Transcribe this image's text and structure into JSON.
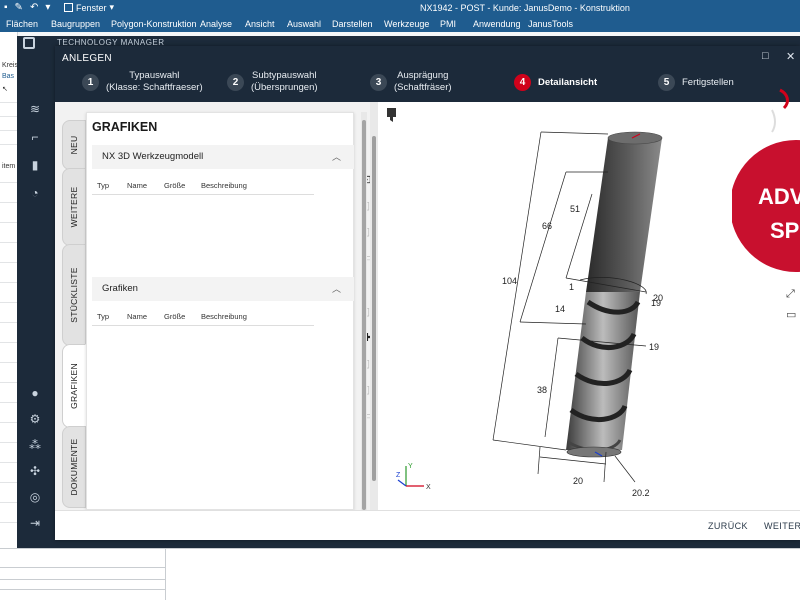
{
  "nx": {
    "title": "NX1942 - POST - Kunde: JanusDemo - Konstruktion",
    "window_menu": "Fenster",
    "menu": [
      "Flächen",
      "Baugruppen",
      "Polygon-Konstruktion",
      "Analyse",
      "Ansicht",
      "Auswahl",
      "Darstellen",
      "Werkzeuge",
      "PMI",
      "Anwendung",
      "JanusTools"
    ],
    "left_strip": [
      "Kreis",
      "Bas",
      "item (N"
    ]
  },
  "tm": {
    "title": "TECHNOLOGY MANAGER"
  },
  "dialog": {
    "title": "ANLEGEN",
    "steps": [
      {
        "num": "1",
        "line1": "Typauswahl",
        "line2": "(Klasse: Schaftfraeser)"
      },
      {
        "num": "2",
        "line1": "Subtypauswahl",
        "line2": "(Übersprungen)"
      },
      {
        "num": "3",
        "line1": "Ausprägung",
        "line2": "(Schaftfräser)"
      },
      {
        "num": "4",
        "line1": "Detailansicht",
        "line2": ""
      },
      {
        "num": "5",
        "line1": "Fertigstellen",
        "line2": ""
      }
    ],
    "active_step": 4,
    "accent": "#d0021b",
    "tabs": [
      "NEU",
      "WEITERE",
      "STÜCKLISTE",
      "GRAFIKEN",
      "DOKUMENTE"
    ],
    "active_tab": "GRAFIKEN",
    "panel": {
      "title": "GRAFIKEN",
      "sections": [
        {
          "title": "NX 3D Werkzeugmodell",
          "columns": [
            "Typ",
            "Name",
            "Größe",
            "Beschreibung"
          ]
        },
        {
          "title": "Grafiken",
          "columns": [
            "Typ",
            "Name",
            "Größe",
            "Beschreibung"
          ]
        }
      ]
    },
    "footer": {
      "back": "ZURÜCK",
      "next": "WEITER"
    }
  },
  "drawing": {
    "dimensions": {
      "overall": "104",
      "d66": "66",
      "d51": "51",
      "d14": "14",
      "d38": "38",
      "d1": "1",
      "d20_top": "20",
      "d19_top": "19",
      "d19": "19",
      "d20": "20",
      "d20_2": "20.2"
    },
    "axis": {
      "x": "X",
      "y": "Y",
      "z": "Z"
    }
  },
  "advent": {
    "line1": "ADV",
    "line2": "SP"
  }
}
